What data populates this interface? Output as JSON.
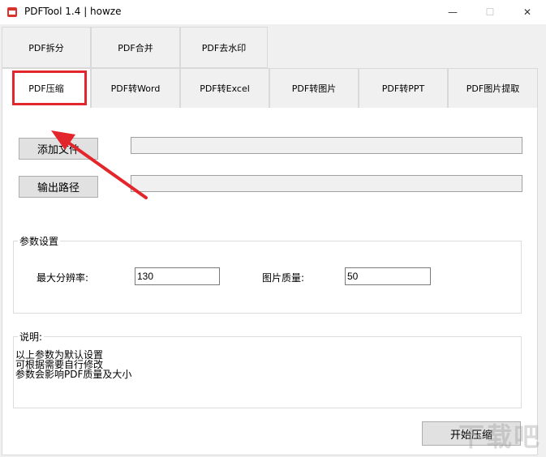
{
  "window": {
    "title": "PDFTool 1.4 |  howze",
    "minimize_glyph": "—",
    "maximize_glyph": "☐",
    "close_glyph": "✕"
  },
  "tabs_row1": [
    {
      "label": "PDF拆分"
    },
    {
      "label": "PDF合并"
    },
    {
      "label": "PDF去水印"
    }
  ],
  "tabs_row2": [
    {
      "label": "PDF压缩"
    },
    {
      "label": "PDF转Word"
    },
    {
      "label": "PDF转Excel"
    },
    {
      "label": "PDF转图片"
    },
    {
      "label": "PDF转PPT"
    },
    {
      "label": "PDF图片提取"
    }
  ],
  "main": {
    "add_file_label": "添加文件",
    "add_file_value": "",
    "output_path_label": "输出路径",
    "output_path_value": "",
    "params": {
      "title": "参数设置",
      "max_resolution_label": "最大分辨率:",
      "max_resolution_value": "130",
      "image_quality_label": "图片质量:",
      "image_quality_value": "50"
    },
    "notes": {
      "title": "说明:",
      "lines": [
        "以上参数为默认设置",
        "可根据需要自行修改",
        "参数会影响PDF质量及大小"
      ]
    },
    "start_label": "开始压缩"
  },
  "watermark": "下载吧",
  "colors": {
    "highlight": "#e3262b",
    "app_icon": "#d9342b"
  }
}
